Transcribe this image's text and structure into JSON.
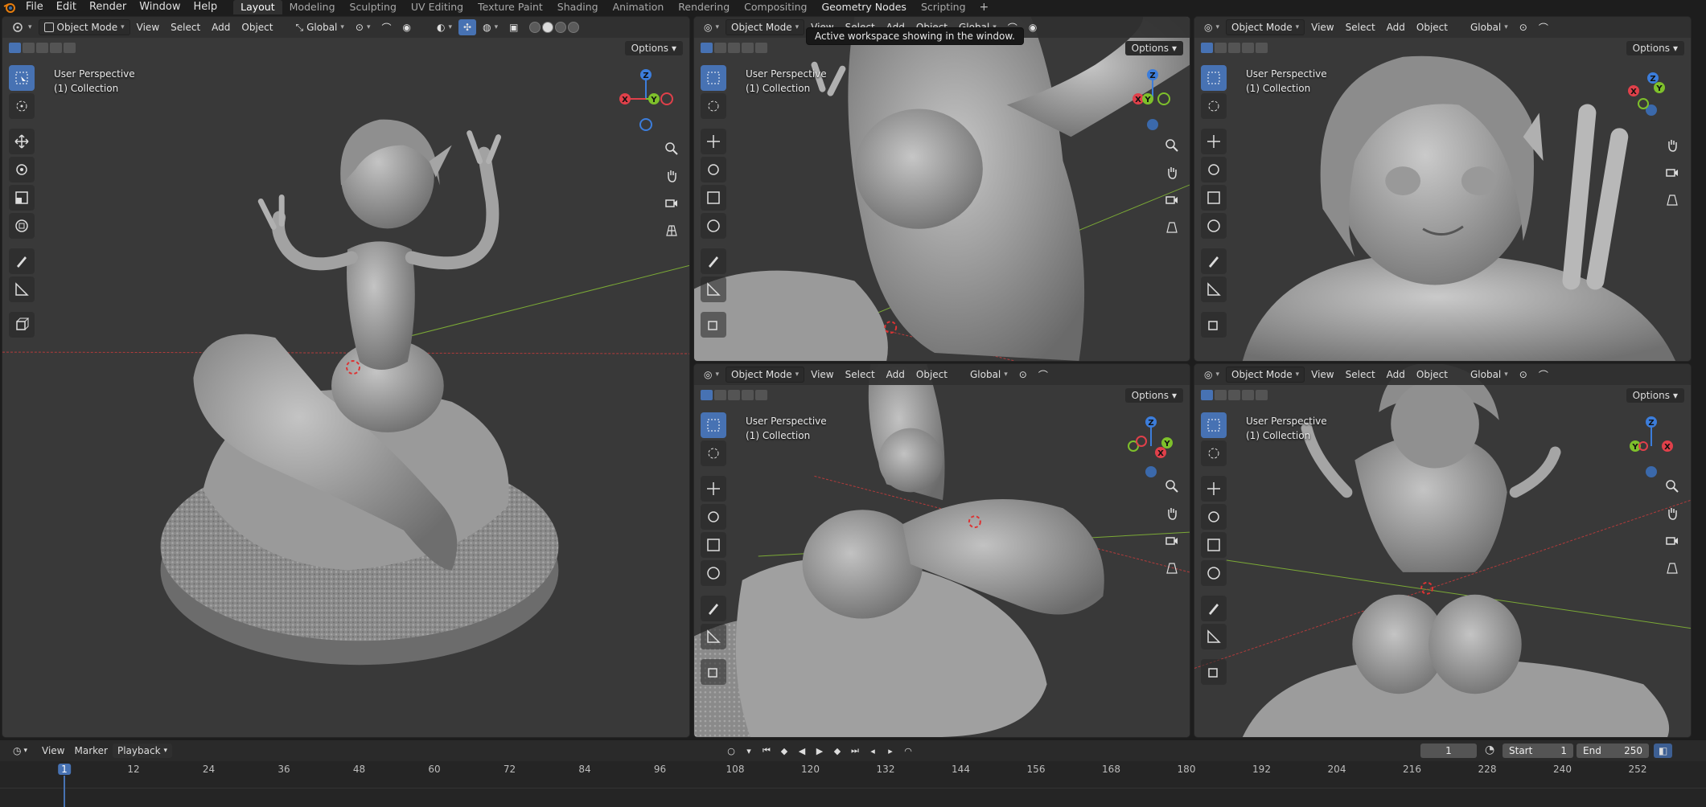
{
  "menu": [
    "File",
    "Edit",
    "Render",
    "Window",
    "Help"
  ],
  "workspaces": [
    {
      "label": "Layout",
      "active": true
    },
    {
      "label": "Modeling",
      "active": false
    },
    {
      "label": "Sculpting",
      "active": false
    },
    {
      "label": "UV Editing",
      "active": false
    },
    {
      "label": "Texture Paint",
      "active": false
    },
    {
      "label": "Shading",
      "active": false
    },
    {
      "label": "Animation",
      "active": false
    },
    {
      "label": "Rendering",
      "active": false
    },
    {
      "label": "Compositing",
      "active": false
    },
    {
      "label": "Geometry Nodes",
      "active": false
    },
    {
      "label": "Scripting",
      "active": false
    }
  ],
  "viewport": {
    "mode": "Object Mode",
    "menus": [
      "View",
      "Select",
      "Add",
      "Object"
    ],
    "transform": "Global",
    "options": "Options",
    "perspective": "User Perspective",
    "collection": "(1) Collection"
  },
  "tooltip": "Active workspace showing in the window.",
  "gizmo_labels": {
    "x": "X",
    "y": "Y",
    "z": "Z"
  },
  "timeline": {
    "menus": [
      "View",
      "Marker",
      "Playback"
    ],
    "current_frame": "1",
    "start_label": "Start",
    "start": "1",
    "end_label": "End",
    "end": "250",
    "ticks": [
      "1",
      "12",
      "24",
      "36",
      "48",
      "60",
      "72",
      "84",
      "96",
      "108",
      "120",
      "132",
      "144",
      "156",
      "168",
      "180",
      "192",
      "204",
      "216",
      "228",
      "240",
      "252"
    ]
  },
  "colors": {
    "accent": "#4772b3",
    "x_axis": "#e0404a",
    "y_axis": "#7ec02b",
    "z_axis": "#3c7ddb",
    "model": "#a9a9a9"
  }
}
